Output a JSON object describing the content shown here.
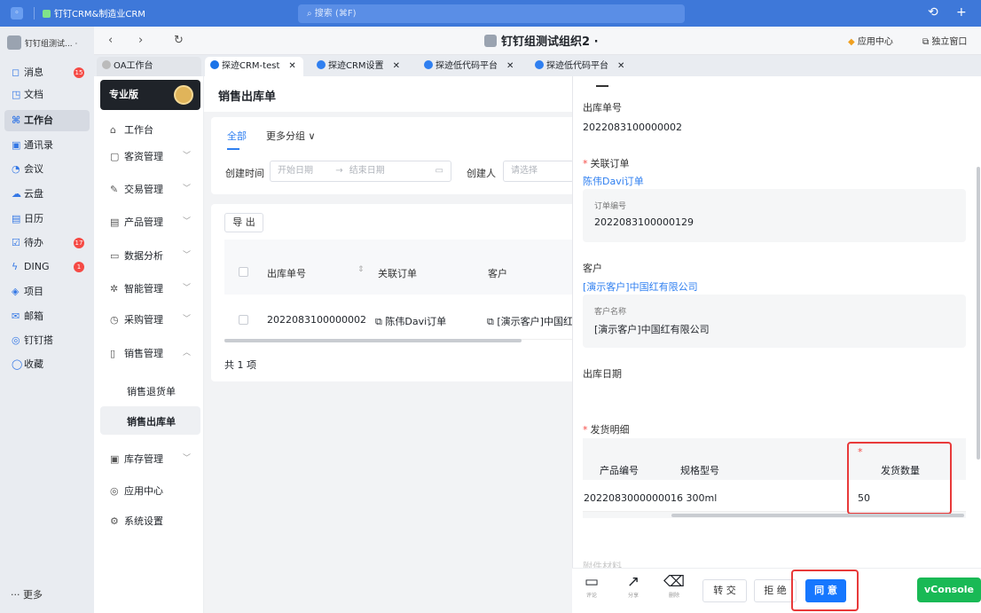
{
  "titlebar": {
    "app_name": "钉钉CRM&制造业CRM",
    "search_placeholder": "搜索 (⌘F)",
    "history_icon": "history-icon",
    "add_icon": "plus-icon"
  },
  "leftnav": {
    "org": "钉钉组测试...",
    "more": "··· 更多",
    "items": [
      {
        "label": "消息",
        "icon": "message-icon",
        "glyph": "◻",
        "badge": "15"
      },
      {
        "label": "文档",
        "icon": "doc-icon",
        "glyph": "◳",
        "badge": ""
      },
      {
        "label": "工作台",
        "icon": "workbench-icon",
        "glyph": "⌘",
        "badge": ""
      },
      {
        "label": "通讯录",
        "icon": "contacts-icon",
        "glyph": "▣",
        "badge": ""
      },
      {
        "label": "会议",
        "icon": "meeting-icon",
        "glyph": "◔",
        "badge": ""
      },
      {
        "label": "云盘",
        "icon": "cloud-icon",
        "glyph": "☁",
        "badge": ""
      },
      {
        "label": "日历",
        "icon": "calendar-icon",
        "glyph": "▤",
        "badge": ""
      },
      {
        "label": "待办",
        "icon": "todo-icon",
        "glyph": "☑",
        "badge": "17"
      },
      {
        "label": "DING",
        "icon": "ding-icon",
        "glyph": "ϟ",
        "badge": "1"
      },
      {
        "label": "项目",
        "icon": "project-icon",
        "glyph": "◈",
        "badge": ""
      },
      {
        "label": "邮箱",
        "icon": "mail-icon",
        "glyph": "✉",
        "badge": ""
      },
      {
        "label": "钉钉搭",
        "icon": "builder-icon",
        "glyph": "◎",
        "badge": ""
      },
      {
        "label": "收藏",
        "icon": "favorite-icon",
        "glyph": "◯",
        "badge": ""
      }
    ]
  },
  "window": {
    "title": "钉钉组测试组织2",
    "app_center": "应用中心",
    "standalone": "独立窗口"
  },
  "tabs": [
    {
      "label": "OA工作台"
    },
    {
      "label": "探迹CRM-test"
    },
    {
      "label": "探迹CRM设置"
    },
    {
      "label": "探迹低代码平台"
    },
    {
      "label": "探迹低代码平台"
    }
  ],
  "sidebar2": {
    "edition": "专业版",
    "items": [
      {
        "label": "工作台",
        "glyph": "⌂",
        "chev": ""
      },
      {
        "label": "客资管理",
        "glyph": "▢",
        "chev": "﹀"
      },
      {
        "label": "交易管理",
        "glyph": "✎",
        "chev": "﹀"
      },
      {
        "label": "产品管理",
        "glyph": "▤",
        "chev": "﹀"
      },
      {
        "label": "数据分析",
        "glyph": "▭",
        "chev": "﹀"
      },
      {
        "label": "智能管理",
        "glyph": "✲",
        "chev": "﹀"
      },
      {
        "label": "采购管理",
        "glyph": "◷",
        "chev": "﹀"
      },
      {
        "label": "销售管理",
        "glyph": "▯",
        "chev": "︿"
      },
      {
        "label": "销售退货单",
        "glyph": "",
        "chev": ""
      },
      {
        "label": "销售出库单",
        "glyph": "",
        "chev": ""
      },
      {
        "label": "库存管理",
        "glyph": "▣",
        "chev": "﹀"
      },
      {
        "label": "应用中心",
        "glyph": "◎",
        "chev": ""
      },
      {
        "label": "系统设置",
        "glyph": "⚙",
        "chev": ""
      }
    ]
  },
  "main": {
    "title": "销售出库单",
    "tab_all": "全部",
    "tab_more": "更多分组 ∨",
    "filter": {
      "created_label": "创建时间",
      "start_placeholder": "开始日期",
      "arrow": "→",
      "end_placeholder": "结束日期",
      "creator_label": "创建人",
      "creator_placeholder": "请选择"
    },
    "export": "导 出",
    "table": {
      "headers": [
        "出库单号",
        "关联订单",
        "客户"
      ],
      "rows": [
        {
          "no": "2022083100000002",
          "order": "陈伟Davi订单",
          "customer": "[演示客户]中国红"
        }
      ]
    },
    "total": "共 1 项"
  },
  "panel": {
    "outbound_no_label": "出库单号",
    "outbound_no": "2022083100000002",
    "order_label": "关联订单",
    "order_link": "陈伟Davi订单",
    "order_sub_label": "订单编号",
    "order_sub_value": "2022083100000129",
    "customer_label": "客户",
    "customer_link": "[演示客户]中国红有限公司",
    "customer_sub_label": "客户名称",
    "customer_sub_value": "[演示客户]中国红有限公司",
    "date_label": "出库日期",
    "detail_label": "发货明细",
    "detail_headers": [
      "产品编号",
      "规格型号",
      "发货数量"
    ],
    "detail_row": {
      "product_no": "2022083000000016",
      "spec": "300ml",
      "qty": "50"
    },
    "partial_label": "附件材料"
  },
  "footer": {
    "comment": "评论",
    "share": "分享",
    "delete": "删除",
    "transfer": "转 交",
    "reject": "拒 绝",
    "approve": "同 意",
    "vconsole": "vConsole"
  },
  "colors": {
    "topbar": "#3e78d9",
    "accent": "#2f7ff0",
    "approve": "#1677ff",
    "highlight": "#e83a3a",
    "vconsole": "#19b955"
  }
}
